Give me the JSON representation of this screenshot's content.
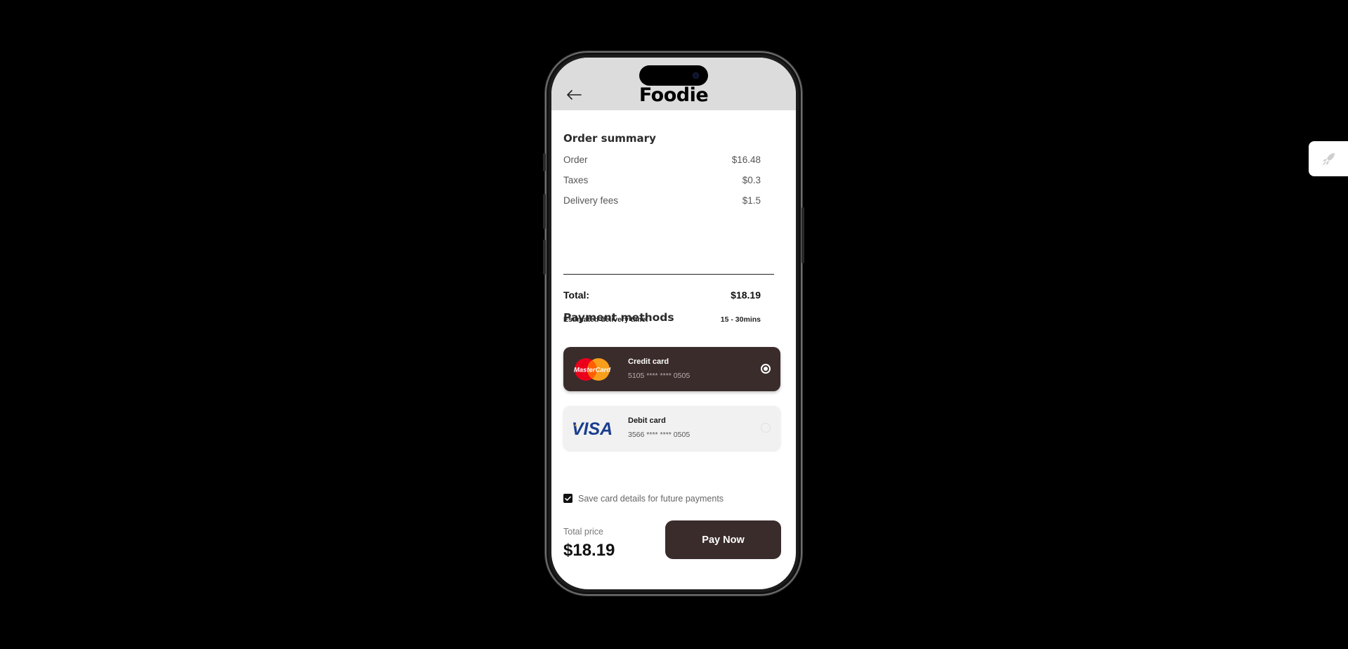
{
  "header": {
    "app_name": "Foodie",
    "back_icon": "arrow-left-icon"
  },
  "order_summary": {
    "title": "Order summary",
    "rows": [
      {
        "label": "Order",
        "value": "$16.48"
      },
      {
        "label": "Taxes",
        "value": "$0.3"
      },
      {
        "label": "Delivery fees",
        "value": "$1.5"
      }
    ],
    "total_label": "Total:",
    "total_value": "$18.19",
    "eta_label": "Estimated delivery time:",
    "eta_value": "15 - 30mins"
  },
  "payment": {
    "title": "Payment methods",
    "cards": [
      {
        "brand": "MasterCard",
        "name": "Credit card",
        "number": "5105 **** **** 0505",
        "selected": true
      },
      {
        "brand": "VISA",
        "name": "Debit card",
        "number": "3566 **** **** 0505",
        "selected": false
      }
    ]
  },
  "save_card": {
    "label": "Save card details for future payments",
    "checked": true
  },
  "footer": {
    "total_label": "Total price",
    "total_value": "$18.19",
    "pay_button": "Pay Now"
  },
  "colors": {
    "accent": "#3b2c2c",
    "header_bg": "#dcdcdc",
    "background": "#000000"
  },
  "floating_widget": {
    "icon": "rocket-icon"
  }
}
